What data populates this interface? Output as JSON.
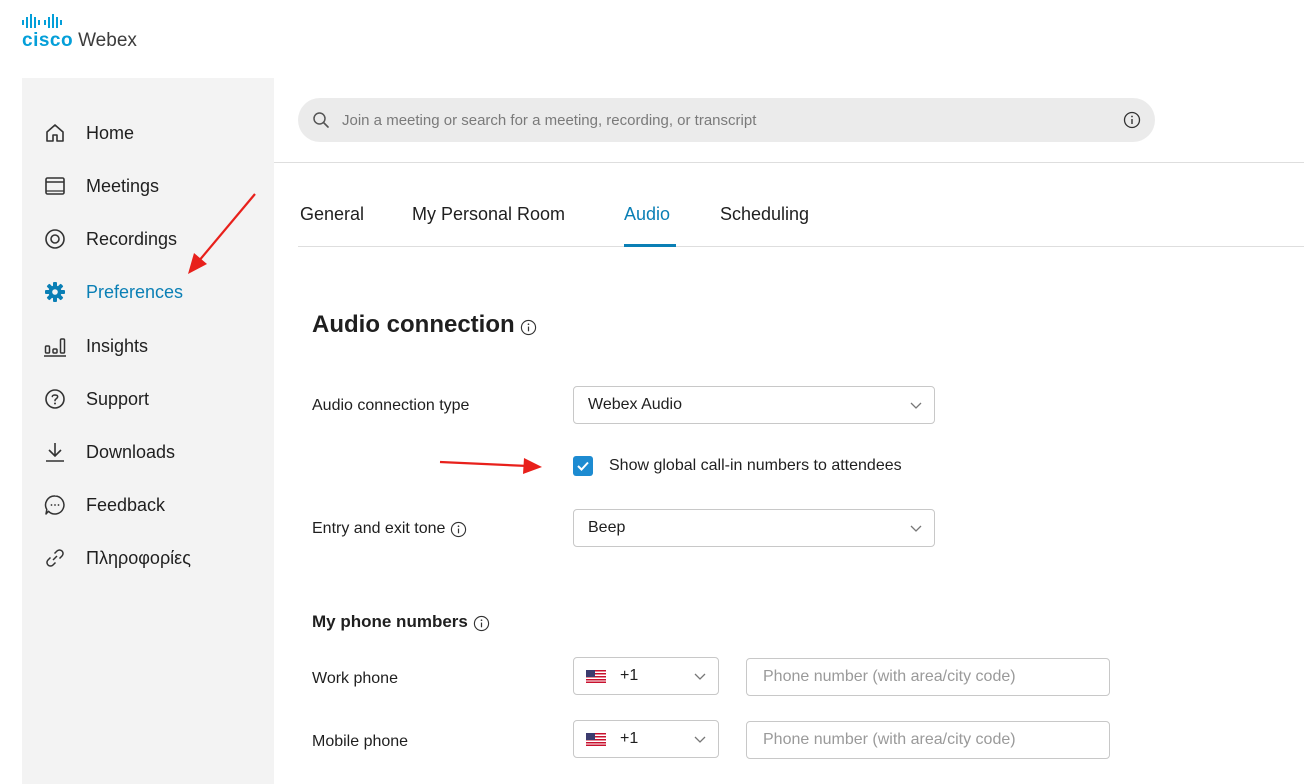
{
  "brand": {
    "cisco": "cisco",
    "product": "Webex",
    "accent_color": "#049fd9"
  },
  "sidebar": {
    "items": [
      {
        "label": "Home",
        "icon": "home-icon",
        "active": false
      },
      {
        "label": "Meetings",
        "icon": "calendar-icon",
        "active": false
      },
      {
        "label": "Recordings",
        "icon": "recordings-icon",
        "active": false
      },
      {
        "label": "Preferences",
        "icon": "gear-icon",
        "active": true
      },
      {
        "label": "Insights",
        "icon": "insights-icon",
        "active": false
      },
      {
        "label": "Support",
        "icon": "help-icon",
        "active": false
      },
      {
        "label": "Downloads",
        "icon": "download-icon",
        "active": false
      },
      {
        "label": "Feedback",
        "icon": "feedback-icon",
        "active": false
      },
      {
        "label": "Πληροφορίες",
        "icon": "link-icon",
        "active": false
      }
    ],
    "active_color": "#0a7fb5"
  },
  "search": {
    "placeholder": "Join a meeting or search for a meeting, recording, or transcript",
    "value": ""
  },
  "tabs": [
    {
      "label": "General",
      "active": false
    },
    {
      "label": "My Personal Room",
      "active": false
    },
    {
      "label": "Audio",
      "active": true
    },
    {
      "label": "Scheduling",
      "active": false
    }
  ],
  "audio": {
    "section_title": "Audio connection",
    "connection_type": {
      "label": "Audio connection type",
      "value": "Webex Audio"
    },
    "show_global": {
      "label": "Show global call-in numbers to attendees",
      "checked": true
    },
    "entry_exit": {
      "label": "Entry and exit tone",
      "value": "Beep"
    }
  },
  "phones": {
    "section_title": "My phone numbers",
    "work": {
      "label": "Work phone",
      "country_code": "+1",
      "placeholder": "Phone number (with area/city code)",
      "value": ""
    },
    "mobile": {
      "label": "Mobile phone",
      "country_code": "+1",
      "placeholder": "Phone number (with area/city code)",
      "value": ""
    }
  },
  "annotation_color": "#e8201b"
}
